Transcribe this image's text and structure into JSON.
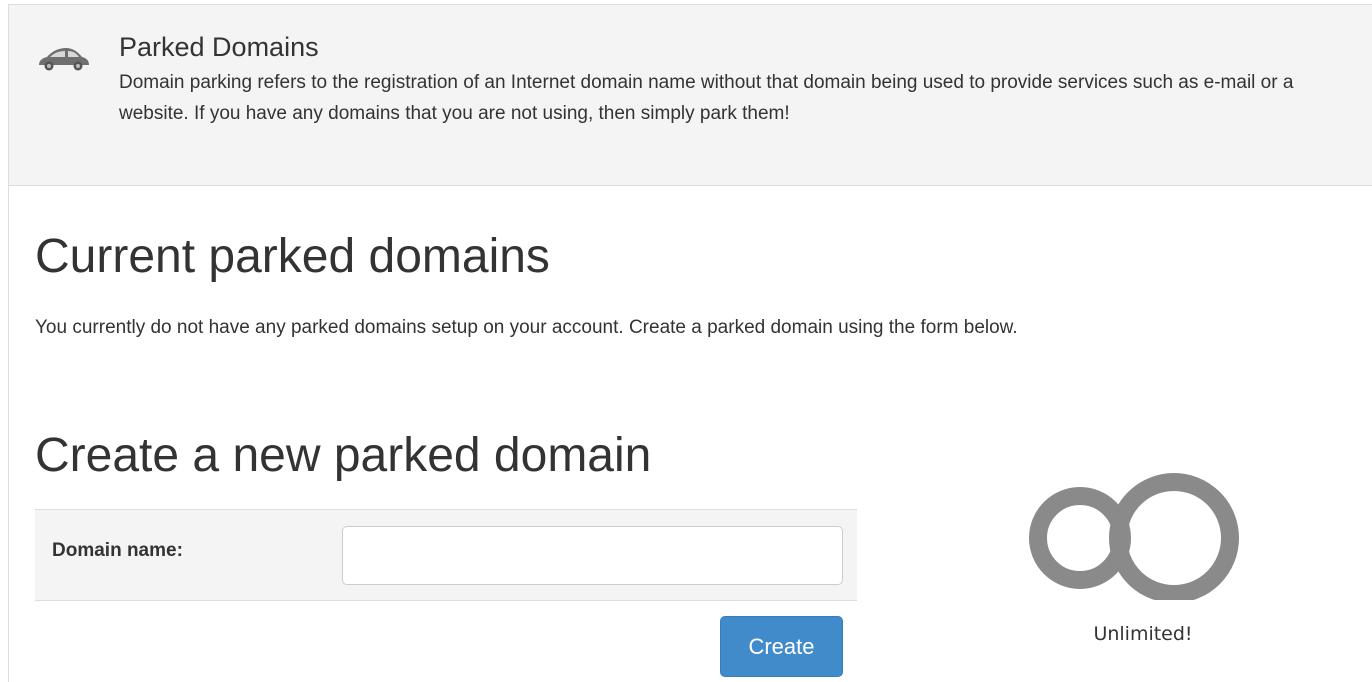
{
  "module": {
    "icon": "car-icon",
    "title": "Parked Domains",
    "description": "Domain parking refers to the registration of an Internet domain name without that domain being used to provide services such as e-mail or a website. If you have any domains that you are not using, then simply park them!"
  },
  "current": {
    "heading": "Current parked domains",
    "message": "You currently do not have any parked domains setup on your account. Create a parked domain using the form below."
  },
  "create": {
    "heading": "Create a new parked domain",
    "domain_label": "Domain name:",
    "domain_value": "",
    "button_label": "Create"
  },
  "quota": {
    "icon": "infinity-icon",
    "label": "Unlimited!"
  },
  "colors": {
    "header_bg": "#f4f4f4",
    "button_bg": "#428bca",
    "infinity": "#8a8a8a"
  }
}
